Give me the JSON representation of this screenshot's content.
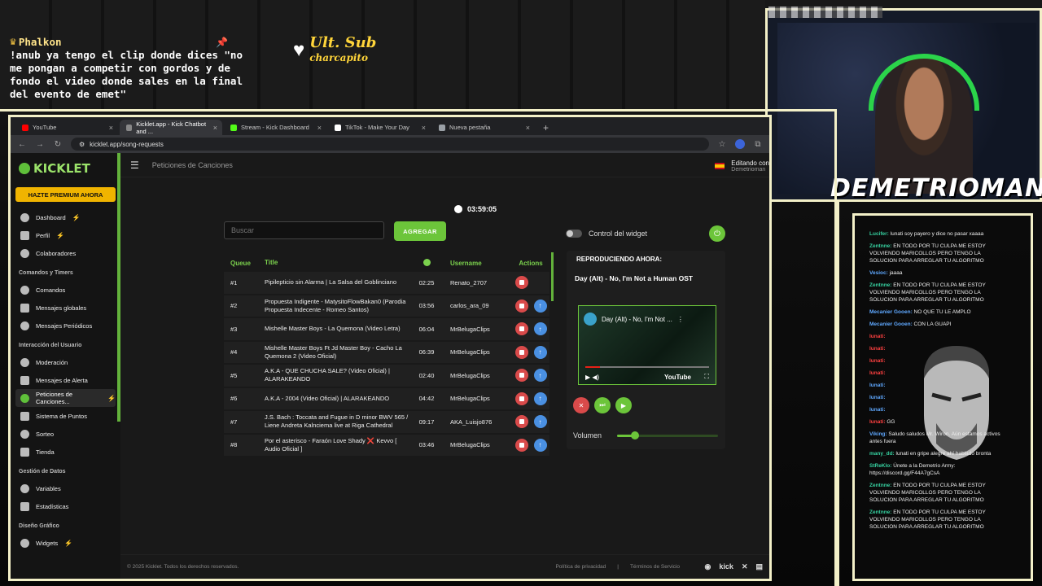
{
  "overlay": {
    "chat_user": "Phalkon",
    "chat_text": "!anub ya tengo el clip donde dices \"no me pongan a competir con gordos y de fondo el video donde sales en la final del evento de emet\"",
    "ult_sub_title": "Ult. Sub",
    "ult_sub_name": "charcapito",
    "streamer_name": "DEMETRIOMAN",
    "stream_chat": [
      {
        "user": "Lucifer:",
        "text": "lunati soy payero y dice no pasar xaaaa",
        "c": "n"
      },
      {
        "user": "Zentnne:",
        "text": "EN TODO POR TU CULPA ME ESTOY VOLVIENDO MARICOLLOS PERO TENGO LA SOLUCION PARA ARREGLAR TU ALGORITMO",
        "c": "n"
      },
      {
        "user": "Vesioc:",
        "text": "jaaaa",
        "c": "n2"
      },
      {
        "user": "Zentnne:",
        "text": "EN TODO POR TU CULPA ME ESTOY VOLVIENDO MARICOLLOS PERO TENGO LA SOLUCION PARA ARREGLAR TU ALGORITMO",
        "c": "n"
      },
      {
        "user": "Mecanier Gooen:",
        "text": "NO QUE TU LE AMPLO",
        "c": "n2"
      },
      {
        "user": "Mecanier Gooen:",
        "text": "CON LA GUAPI",
        "c": "n2"
      },
      {
        "user": "lunati:",
        "text": "",
        "c": "n3"
      },
      {
        "user": "lunati:",
        "text": "",
        "c": "n3"
      },
      {
        "user": "lunati:",
        "text": "",
        "c": "n3"
      },
      {
        "user": "lunati:",
        "text": "",
        "c": "n3"
      },
      {
        "user": "lunati:",
        "text": "",
        "c": "n2"
      },
      {
        "user": "lunati:",
        "text": "",
        "c": "n2"
      },
      {
        "user": "lunati:",
        "text": "",
        "c": "n2"
      },
      {
        "user": "lunati:",
        "text": "GG",
        "c": "n3"
      },
      {
        "user": "Viking:",
        "text": "Saludo saludos Mr. Wiron. Aún estamos activos antes fuera",
        "c": "n2"
      },
      {
        "user": "many_dd:",
        "text": "lunati en gripe alegre ahí hablado bronta",
        "c": "n"
      },
      {
        "user": "StReKlo:",
        "text": "Únete a la Demetrio Army: https://discord.gg/F44A7gCsA",
        "c": "n"
      },
      {
        "user": "Zentnne:",
        "text": "EN TODO POR TU CULPA ME ESTOY VOLVIENDO MARICOLLOS PERO TENGO LA SOLUCION PARA ARREGLAR TU ALGORITMO",
        "c": "n"
      },
      {
        "user": "Zentnne:",
        "text": "EN TODO POR TU CULPA ME ESTOY VOLVIENDO MARICOLLOS PERO TENGO LA SOLUCION PARA ARREGLAR TU ALGORITMO",
        "c": "n"
      }
    ]
  },
  "browser": {
    "tabs": [
      {
        "label": "YouTube",
        "color": "#ff0000",
        "active": false
      },
      {
        "label": "Kicklet.app - Kick Chatbot and ...",
        "color": "#888888",
        "active": true
      },
      {
        "label": "Stream - Kick Dashboard",
        "color": "#53fc18",
        "active": false
      },
      {
        "label": "TikTok - Make Your Day",
        "color": "#ffffff",
        "active": false
      },
      {
        "label": "Nueva pestaña",
        "color": "#9aa0a6",
        "active": false
      }
    ],
    "url": "kicklet.app/song-requests"
  },
  "sidebar": {
    "logo": "KICKLET",
    "premium": "HAZTE PREMIUM AHORA",
    "items_top": [
      {
        "label": "Dashboard",
        "bolt": true
      },
      {
        "label": "Perfil",
        "bolt": true
      },
      {
        "label": "Colaboradores",
        "bolt": false
      }
    ],
    "section1": "Comandos y Timers",
    "items1": [
      "Comandos",
      "Mensajes globales",
      "Mensajes Periódicos"
    ],
    "section2": "Interacción del Usuario",
    "items2": [
      "Moderación",
      "Mensajes de Alerta",
      "Peticiones de Canciones...",
      "Sistema de Puntos",
      "Sorteo",
      "Tienda"
    ],
    "section3": "Gestión de Datos",
    "items3": [
      "Variables",
      "Estadísticas"
    ],
    "section4": "Diseño Gráfico",
    "items4": [
      "Widgets"
    ]
  },
  "page": {
    "title": "Peticiones de Canciones",
    "editing": "Editando con",
    "editing_user": "Demetrioman",
    "timer": "03:59:05",
    "search_placeholder": "Buscar",
    "add_button": "AGREGAR",
    "widget_control": "Control del widget",
    "now_playing_label": "REPRODUCIENDO AHORA:",
    "now_playing_song": "Day (Alt) - No, I'm Not a Human OST",
    "video_title": "Day (Alt) - No, I'm Not ...",
    "video_brand": "YouTube",
    "volume_label": "Volumen",
    "volume": 0.18,
    "footer": "© 2025 Kicklet. Todos los derechos reservados.",
    "privacy": "Política de privacidad",
    "terms": "Términos de Servicio",
    "footer_sep": "|",
    "social": "kick"
  },
  "queue": {
    "headers": {
      "queue": "Queue",
      "title": "Title",
      "username": "Username",
      "actions": "Actions"
    },
    "rows": [
      {
        "n": "#1",
        "title": "Pipilepticio sin Alarma | La Salsa del Goblinciano",
        "dur": "02:25",
        "user": "Renato_2707",
        "up": false
      },
      {
        "n": "#2",
        "title": "Propuesta Indigente - MatysitoFlowBakan0 (Parodia Propuesta Indecente - Romeo Santos)",
        "dur": "03:56",
        "user": "carlos_ara_09",
        "up": true
      },
      {
        "n": "#3",
        "title": "Mishelle Master Boys - La Quemona (Video Letra)",
        "dur": "06:04",
        "user": "MrBelugaClips",
        "up": true
      },
      {
        "n": "#4",
        "title": "Mishelle Master Boys Ft Jd Master Boy - Cacho La Quemona 2 (Video Oficial)",
        "dur": "06:39",
        "user": "MrBelugaClips",
        "up": true
      },
      {
        "n": "#5",
        "title": "A.K.A - QUE CHUCHA SALE? (Video Oficial) | ALARAKEANDO",
        "dur": "02:40",
        "user": "MrBelugaClips",
        "up": true
      },
      {
        "n": "#6",
        "title": "A.K.A - 2004 (Video Oficial) | ALARAKEANDO",
        "dur": "04:42",
        "user": "MrBelugaClips",
        "up": true
      },
      {
        "n": "#7",
        "title": "J.S. Bach : Toccata and Fugue in D minor BWV 565 / Liene Andreta Kalnciema live at Riga Cathedral",
        "dur": "09:17",
        "user": "AKA_Luisjo876",
        "up": true
      },
      {
        "n": "#8",
        "title": "Por el asterisco - Faraón Love Shady ❌ Kevvo [ Audio Oficial ]",
        "dur": "03:46",
        "user": "MrBelugaClips",
        "up": true
      }
    ]
  }
}
